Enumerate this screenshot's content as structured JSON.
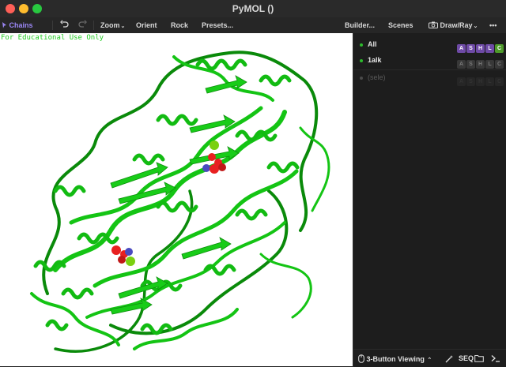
{
  "window": {
    "title": "PyMOL ()"
  },
  "toolbar": {
    "chains": "Chains",
    "undo_icon": "undo-icon",
    "redo_icon": "redo-icon",
    "zoom": "Zoom",
    "orient": "Orient",
    "rock": "Rock",
    "presets": "Presets...",
    "builder": "Builder...",
    "scenes": "Scenes",
    "draw_ray": "Draw/Ray",
    "more": "•••"
  },
  "viewer": {
    "watermark": "For Educational Use Only",
    "protein_color": "#10c010",
    "ligand_colors": {
      "oxygen": "#e82020",
      "nitrogen": "#4a4ac0",
      "metal": "#7ad010"
    }
  },
  "panel": {
    "objects": [
      {
        "name": "All",
        "active": true,
        "buttons": [
          "A",
          "S",
          "H",
          "L",
          "C"
        ]
      },
      {
        "name": "1alk",
        "active": true,
        "buttons": [
          "A",
          "S",
          "H",
          "L",
          "C"
        ]
      },
      {
        "name": "(sele)",
        "active": false,
        "buttons": [
          "A",
          "S",
          "H",
          "L",
          "C"
        ]
      }
    ]
  },
  "statusbar": {
    "mouse_mode": "3-Button Viewing",
    "seq": "SEQ"
  }
}
